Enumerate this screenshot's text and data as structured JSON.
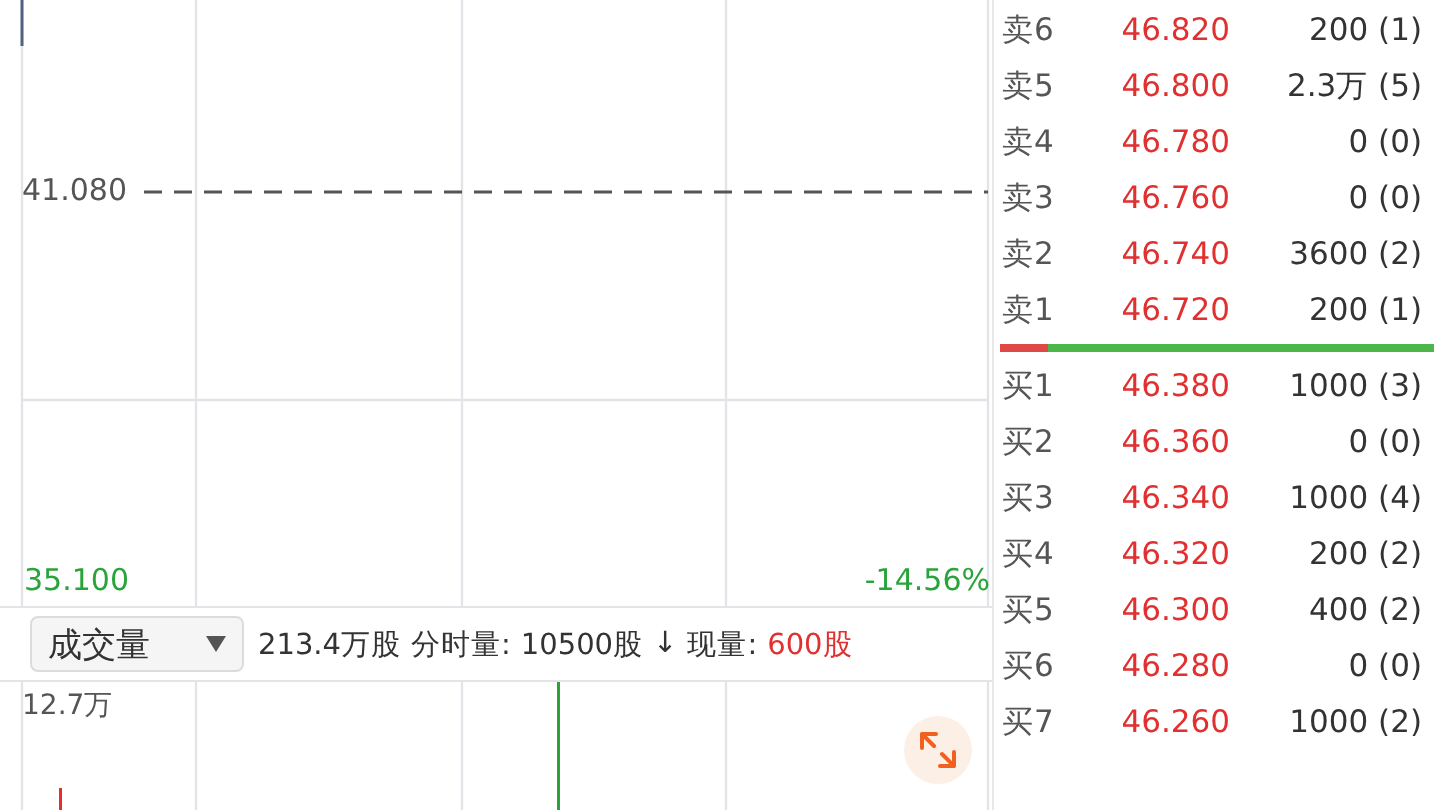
{
  "price_chart": {
    "reference_price": "41.080",
    "low_price": "35.100",
    "low_change": "-14.56%"
  },
  "volume_header": {
    "selector": "成交量",
    "total": "213.4万股",
    "tick_label": "分时量:",
    "tick_volume": "10500股",
    "direction": "↓",
    "current_label": "现量:",
    "current_volume": "600股"
  },
  "volume_chart": {
    "max_label": "12.7万"
  },
  "order_book": {
    "asks": [
      {
        "label": "卖6",
        "price": "46.820",
        "volume": "200 (1)"
      },
      {
        "label": "卖5",
        "price": "46.800",
        "volume": "2.3万 (5)"
      },
      {
        "label": "卖4",
        "price": "46.780",
        "volume": "0 (0)"
      },
      {
        "label": "卖3",
        "price": "46.760",
        "volume": "0 (0)"
      },
      {
        "label": "卖2",
        "price": "46.740",
        "volume": "3600 (2)"
      },
      {
        "label": "卖1",
        "price": "46.720",
        "volume": "200 (1)"
      }
    ],
    "ratio": {
      "level": 0.11
    },
    "bids": [
      {
        "label": "买1",
        "price": "46.380",
        "volume": "1000 (3)"
      },
      {
        "label": "买2",
        "price": "46.360",
        "volume": "0 (0)"
      },
      {
        "label": "买3",
        "price": "46.340",
        "volume": "1000 (4)"
      },
      {
        "label": "买4",
        "price": "46.320",
        "volume": "200 (2)"
      },
      {
        "label": "买5",
        "price": "46.300",
        "volume": "400 (2)"
      },
      {
        "label": "买6",
        "price": "46.280",
        "volume": "0 (0)"
      },
      {
        "label": "买7",
        "price": "46.260",
        "volume": "1000 (2)"
      }
    ]
  }
}
